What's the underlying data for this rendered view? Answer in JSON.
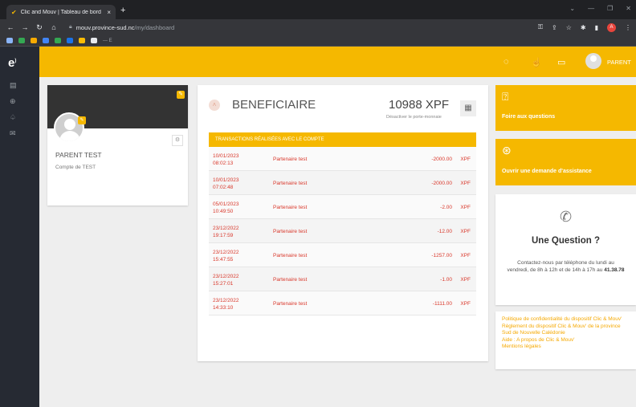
{
  "browser": {
    "tab_title": "Clic and Mouv | Tableau de bord",
    "tab_close": "×",
    "new_tab": "+",
    "url_host": "mouv.province-sud.nc",
    "url_path": "/my/dashboard",
    "profile_initial": "A",
    "bookmark_text": "— E"
  },
  "app": {
    "logo": "e",
    "user_label": "PARENT"
  },
  "profile": {
    "name": "PARENT TEST",
    "subtitle": "Compte de TEST"
  },
  "beneficiaire": {
    "title": "BENEFICIAIRE",
    "balance": "10988 XPF",
    "deactivate_label": "Désactiver le porte-monnaie",
    "table_title": "TRANSACTIONS RÉALISÉES AVEC LE COMPTE",
    "transactions": [
      {
        "date": "10/01/2023",
        "time": "08:02:13",
        "partner": "Partenaire test",
        "amount": "-2000.00",
        "currency": "XPF"
      },
      {
        "date": "10/01/2023",
        "time": "07:02:48",
        "partner": "Partenaire test",
        "amount": "-2000.00",
        "currency": "XPF"
      },
      {
        "date": "05/01/2023",
        "time": "10:49:50",
        "partner": "Partenaire test",
        "amount": "-2.00",
        "currency": "XPF"
      },
      {
        "date": "23/12/2022",
        "time": "19:17:59",
        "partner": "Partenaire test",
        "amount": "-12.00",
        "currency": "XPF"
      },
      {
        "date": "23/12/2022",
        "time": "15:47:55",
        "partner": "Partenaire test",
        "amount": "-1257.00",
        "currency": "XPF"
      },
      {
        "date": "23/12/2022",
        "time": "15:27:01",
        "partner": "Partenaire test",
        "amount": "-1.00",
        "currency": "XPF"
      },
      {
        "date": "23/12/2022",
        "time": "14:33:10",
        "partner": "Partenaire test",
        "amount": "-1111.00",
        "currency": "XPF"
      }
    ]
  },
  "faq": {
    "label": "Foire aux questions"
  },
  "assistance": {
    "label": "Ouvrir une demande d'assistance"
  },
  "question": {
    "title": "Une Question ?",
    "text": "Contactez-nous par téléphone du lundi au vendredi, de 8h à 12h et de 14h à 17h au",
    "phone": "41.38.78"
  },
  "links": [
    "Politique de confidentialité du dispositif Clic & Mouv'",
    "Règlement du dispositif Clic & Mouv' de la province Sud de Nouvelle Calédonie",
    "Aide : A propos de Clic & Mouv'",
    "Mentions légales"
  ],
  "colors": {
    "accent": "#f5b800",
    "sidebar": "#262a33",
    "strike_red": "#d9382b"
  }
}
